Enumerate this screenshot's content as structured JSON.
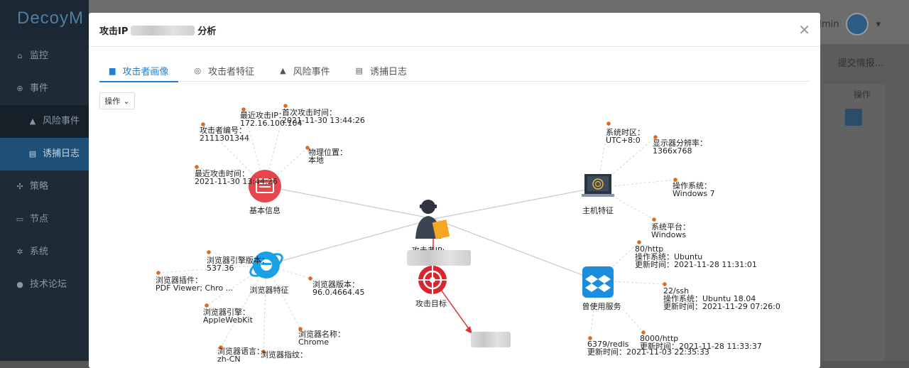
{
  "app": {
    "brand": "DecoyM",
    "nav": [
      {
        "icon": "home-icon",
        "label": "监控"
      },
      {
        "icon": "event-icon",
        "label": "事件"
      },
      {
        "icon": "bell-icon",
        "label": "风险事件"
      },
      {
        "icon": "log-icon",
        "label": "诱捕日志"
      },
      {
        "icon": "strategy-icon",
        "label": "策略"
      },
      {
        "icon": "monitor-icon",
        "label": "节点"
      },
      {
        "icon": "gear-icon",
        "label": "系统"
      },
      {
        "icon": "chat-icon",
        "label": "技术论坛"
      }
    ],
    "user": "admin",
    "submit_button": "提交情报...",
    "table_header": "操作"
  },
  "modal": {
    "title_prefix": "攻击IP",
    "title_suffix": "分析",
    "tabs": [
      {
        "label": "攻击者画像",
        "icon": "picture-icon"
      },
      {
        "label": "攻击者特征",
        "icon": "fingerprint-icon"
      },
      {
        "label": "风险事件",
        "icon": "bell-icon"
      },
      {
        "label": "诱捕日志",
        "icon": "document-icon"
      }
    ],
    "active_tab": 0,
    "operation_dropdown": "操作"
  },
  "graph": {
    "center": {
      "label": "攻击者IP:"
    },
    "basic": {
      "caption": "基本信息",
      "leaves": [
        "最近攻击IP：\n172.16.100.104",
        "首次攻击时间：\n2021-11-30 13:44:26",
        "攻击者编号：\n2111301344",
        "物理位置：\n本地",
        "最近攻击时间：\n2021-11-30 13:44:26"
      ]
    },
    "host": {
      "caption": "主机特征",
      "leaves": [
        "系统时区：\nUTC+8:0",
        "显示器分辨率：\n1366x768",
        "操作系统：\nWindows 7",
        "系统平台：\nWindows"
      ]
    },
    "browser": {
      "caption": "浏览器特征",
      "leaves": [
        "浏览器引擎版本：\n537.36",
        "浏览器插件：\nPDF Viewer; Chro ...",
        "浏览器版本：\n96.0.4664.45",
        "浏览器引擎：\nAppleWebKit",
        "浏览器名称：\nChrome",
        "浏览器语言：\nzh-CN",
        "浏览器指纹："
      ]
    },
    "target": {
      "caption": "攻击目标"
    },
    "services": {
      "caption": "曾使用服务",
      "leaves": [
        "80/http\n操作系统：Ubuntu\n更新时间：2021-11-28 11:31:01",
        "22/ssh\n操作系统：Ubuntu 18.04\n更新时间：2021-11-29 07:26:0",
        "8000/http\n更新时间：2021-11-28 11:33:37",
        "6379/redis\n更新时间：2021-11-03 22:35:33"
      ]
    }
  }
}
